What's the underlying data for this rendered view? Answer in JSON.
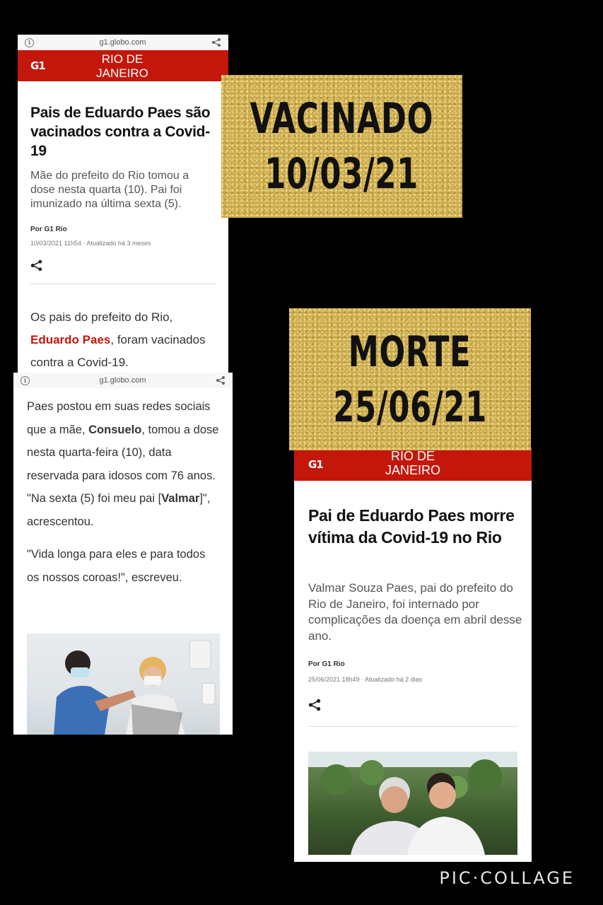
{
  "card1": {
    "url": "g1.globo.com",
    "logo": "G1",
    "region_line1": "RIO DE",
    "region_line2": "JANEIRO",
    "headline": "Pais de Eduardo Paes são vacinados contra a Covid-19",
    "subhead": "Mãe do prefeito do Rio tomou a dose nesta quarta (10). Pai foi imunizado na última sexta (5).",
    "byline": "Por G1 Rio",
    "date": "10/03/2021 11h54 · Atualizado há 3 meses",
    "body_part1": "Os pais do prefeito do Rio, ",
    "body_link": "Eduardo Paes",
    "body_part2": ", foram vacinados contra a Covid-19."
  },
  "card2": {
    "url": "g1.globo.com",
    "p1_a": "Paes postou em suas redes sociais que a mãe, ",
    "p1_b": "Consuelo",
    "p1_c": ", tomou a dose nesta quarta-feira (10), data reservada para idosos com 76 anos. \"Na sexta (5) foi meu pai [",
    "p1_d": "Valmar",
    "p1_e": "]\", acrescentou.",
    "p2": "\"Vida longa para eles e para todos os nossos coroas!\", escreveu."
  },
  "gold1": {
    "line1": "VACINADO",
    "line2": "10/03/21"
  },
  "gold2": {
    "line1": "MORTE",
    "line2": "25/06/21"
  },
  "card3": {
    "logo": "G1",
    "region_line1": "RIO DE",
    "region_line2": "JANEIRO",
    "headline": "Pai de Eduardo Paes morre vítima da Covid-19 no Rio",
    "subhead": "Valmar Souza Paes, pai do prefeito do Rio de Janeiro, foi internado por complicações da doença em abril desse ano.",
    "byline": "Por G1 Rio",
    "date": "25/06/2021 18h49 · Atualizado há 2 dias"
  },
  "watermark": "PIC·COLLAGE",
  "icons": [
    "info-icon",
    "share-icon"
  ],
  "colors": {
    "g1_red": "#c4170c",
    "gold": "#c9aa4d",
    "background": "#000000"
  }
}
